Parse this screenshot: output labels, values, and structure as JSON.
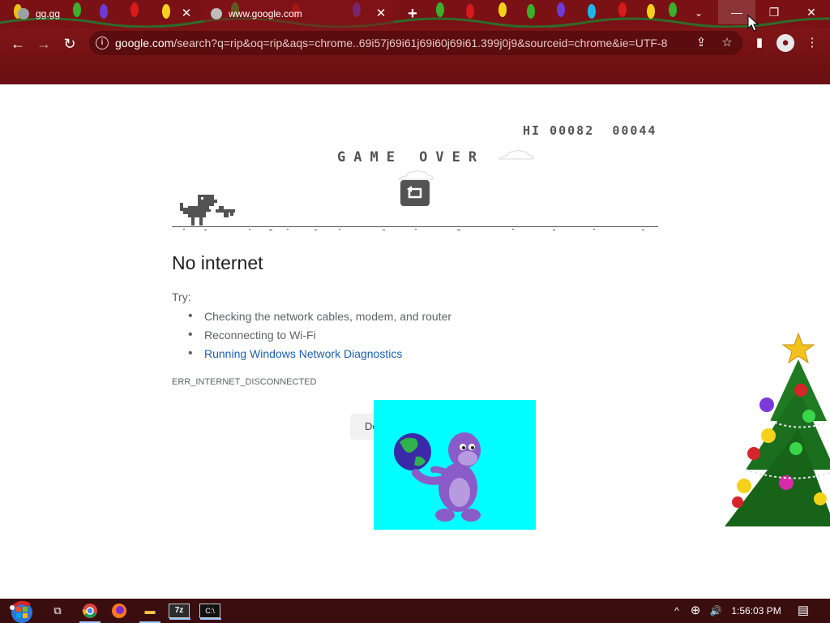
{
  "browser": {
    "tabs": [
      {
        "title": "gg.gg",
        "close": "✕"
      },
      {
        "title": "www.google.com",
        "close": "✕"
      }
    ],
    "new_tab": "+",
    "tab_search": "⌄",
    "window_controls": {
      "minimize": "—",
      "restore": "❐",
      "close": "✕"
    },
    "nav": {
      "back": "←",
      "forward": "→",
      "reload": "↻"
    },
    "omnibox": {
      "host": "google.com",
      "path": "/search?q=rip&oq=rip&aqs=chrome..69i57j69i61j69i60j69i61.399j0j9&sourceid=chrome&ie=UTF-8",
      "info_icon": "i"
    },
    "toolbar_icons": {
      "share": "⇪",
      "bookmark": "☆",
      "sidepanel": "▮",
      "profile": "●",
      "menu": "⋮"
    }
  },
  "game": {
    "hi_label": "HI",
    "hi_score": "00082",
    "score": "00044",
    "game_over": "GAME OVER"
  },
  "error": {
    "heading": "No internet",
    "try_label": "Try:",
    "suggestions": [
      {
        "text": "Checking the network cables, modem, and router"
      },
      {
        "text": "Reconnecting to Wi-Fi"
      },
      {
        "text": "Running Windows Network Diagnostics"
      }
    ],
    "code": "ERR_INTERNET_DISCONNECTED",
    "details_button": "Details"
  },
  "taskbar": {
    "apps": [
      "Task View",
      "Chrome",
      "Firefox",
      "File Explorer",
      "7-Zip",
      "Command Prompt"
    ],
    "app_glyphs": {
      "taskview": "⧉",
      "explorer": "▬",
      "sevenzip": "7z",
      "cmd": "C:\\"
    },
    "tray": {
      "chevron": "^",
      "network": "⊕",
      "volume": "🔊",
      "notifications": "▤"
    },
    "clock": "1:56:03 PM"
  },
  "colors": {
    "frame_dark": "#7a1114",
    "game_gray": "#535353",
    "link_blue": "#1a5fb4",
    "bonzi_bg": "#00ffff"
  }
}
